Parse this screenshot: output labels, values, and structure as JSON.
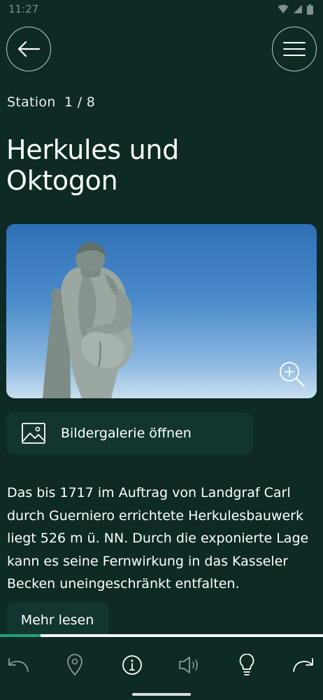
{
  "status": {
    "time": "11:27"
  },
  "header": {
    "station_label": "Station",
    "station_counter": "1 / 8"
  },
  "page": {
    "title_line1": "Herkules und",
    "title_line2": "Oktogon"
  },
  "gallery": {
    "label": "Bildergalerie öffnen"
  },
  "body": {
    "text": "Das bis 1717 im Auftrag von Landgraf Carl durch Guerniero errichtete Herkulesbauwerk liegt 526 m ü. NN. Durch die exponierte Lage kann es seine Fernwirkung in das Kasseler Becken uneingeschränkt entfalten.",
    "more_label": "Mehr lesen"
  },
  "progress": {
    "fraction": 0.125
  },
  "nav": {
    "items": [
      {
        "icon": "undo-icon"
      },
      {
        "icon": "location-pin-icon"
      },
      {
        "icon": "info-icon"
      },
      {
        "icon": "speaker-icon"
      },
      {
        "icon": "lightbulb-icon"
      },
      {
        "icon": "redo-icon"
      }
    ]
  },
  "colors": {
    "background": "#0d2a24",
    "surface": "#12362f",
    "accent": "#1fa07d"
  }
}
